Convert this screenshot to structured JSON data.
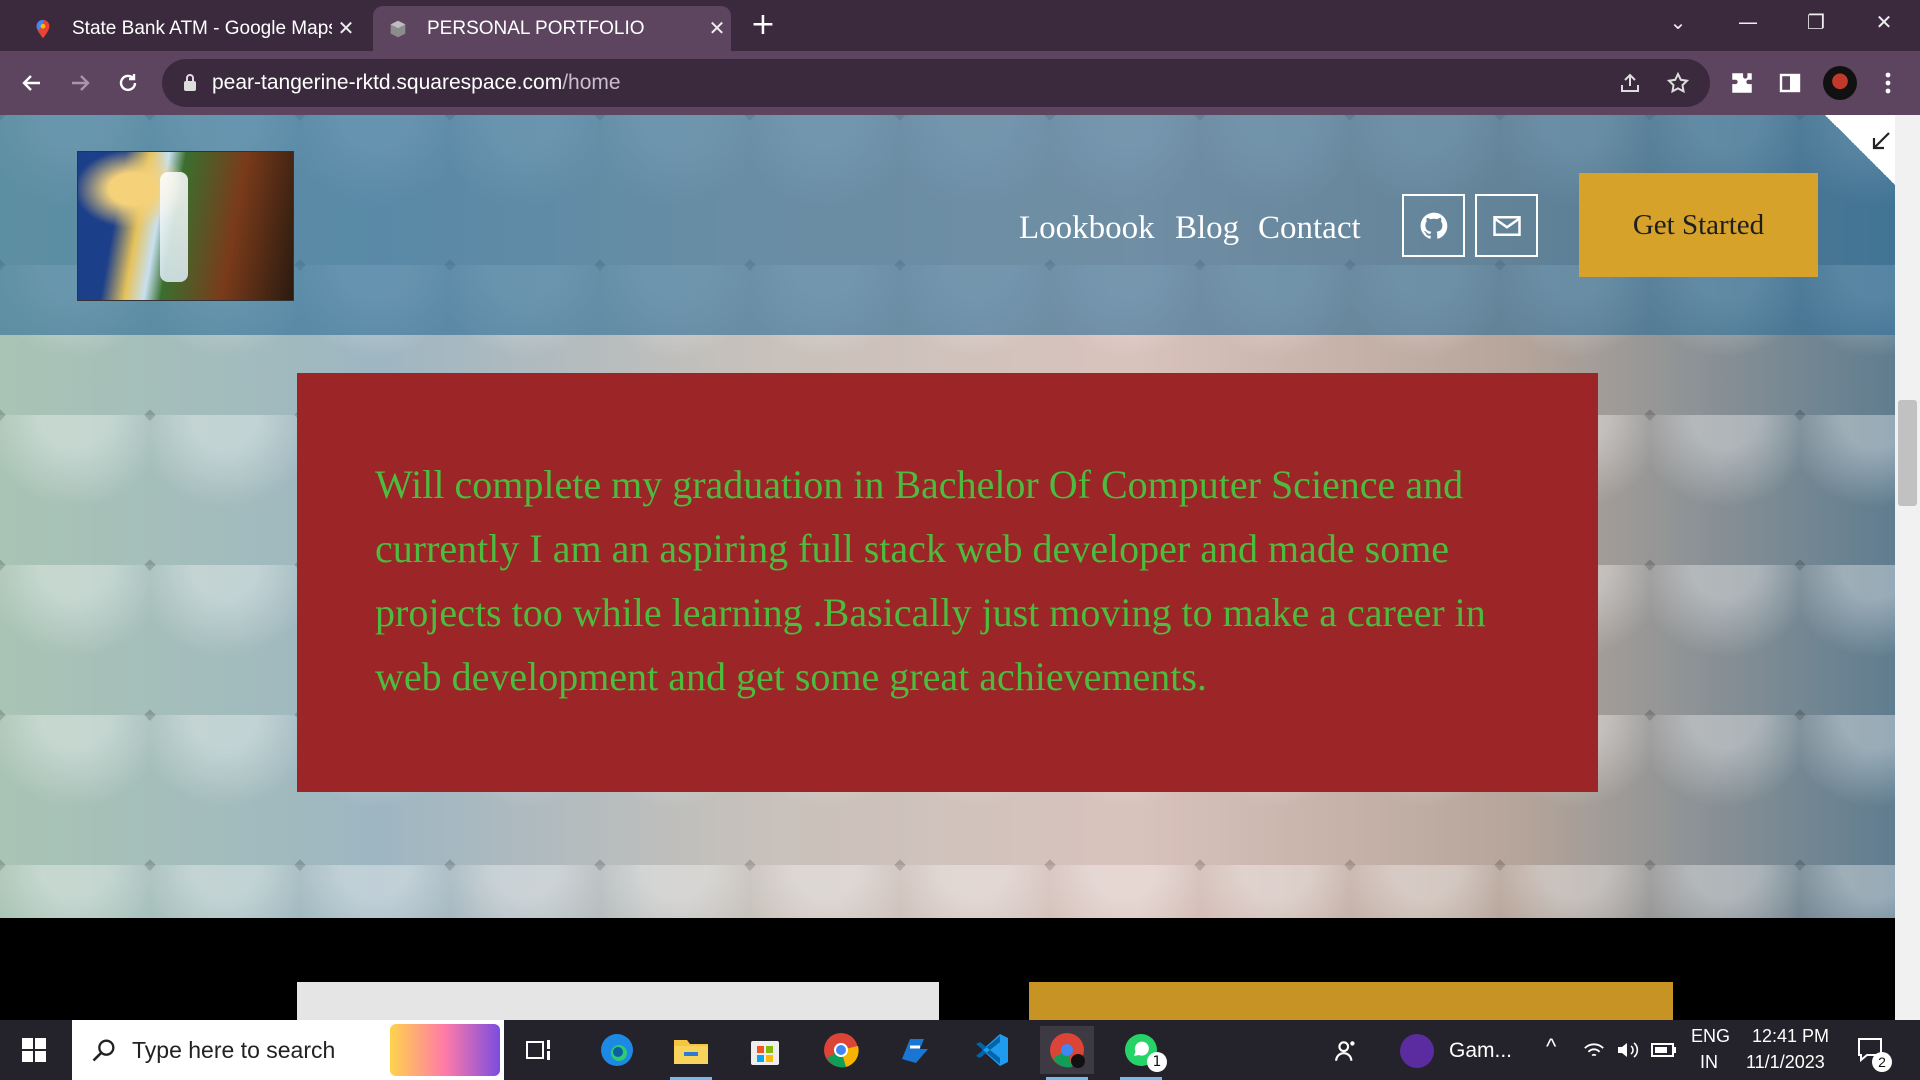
{
  "browser": {
    "tabs": [
      {
        "title": "State Bank ATM - Google Maps",
        "active": false
      },
      {
        "title": "PERSONAL PORTFOLIO",
        "active": true
      }
    ],
    "url_host": "pear-tangerine-rktd.squarespace.com",
    "url_path": "/home"
  },
  "site": {
    "nav": [
      "Lookbook",
      "Blog",
      "Contact"
    ],
    "cta_label": "Get Started",
    "about_text": "Will complete my graduation in Bachelor Of Computer Science and currently I am an aspiring full stack web developer and  made some projects too while learning .Basically just moving to make a career in web development and get some great achievements."
  },
  "taskbar": {
    "search_placeholder": "Type here to search",
    "game_label": "Gam...",
    "language": "ENG",
    "region": "IN",
    "time": "12:41 PM",
    "date": "11/1/2023",
    "notification_count": "2",
    "whatsapp_badge": "1"
  },
  "colors": {
    "card_bg": "#9b2527",
    "card_text": "#4dbb3f",
    "cta_bg": "#d6a22a",
    "browser_frame": "#3b2a3e"
  }
}
